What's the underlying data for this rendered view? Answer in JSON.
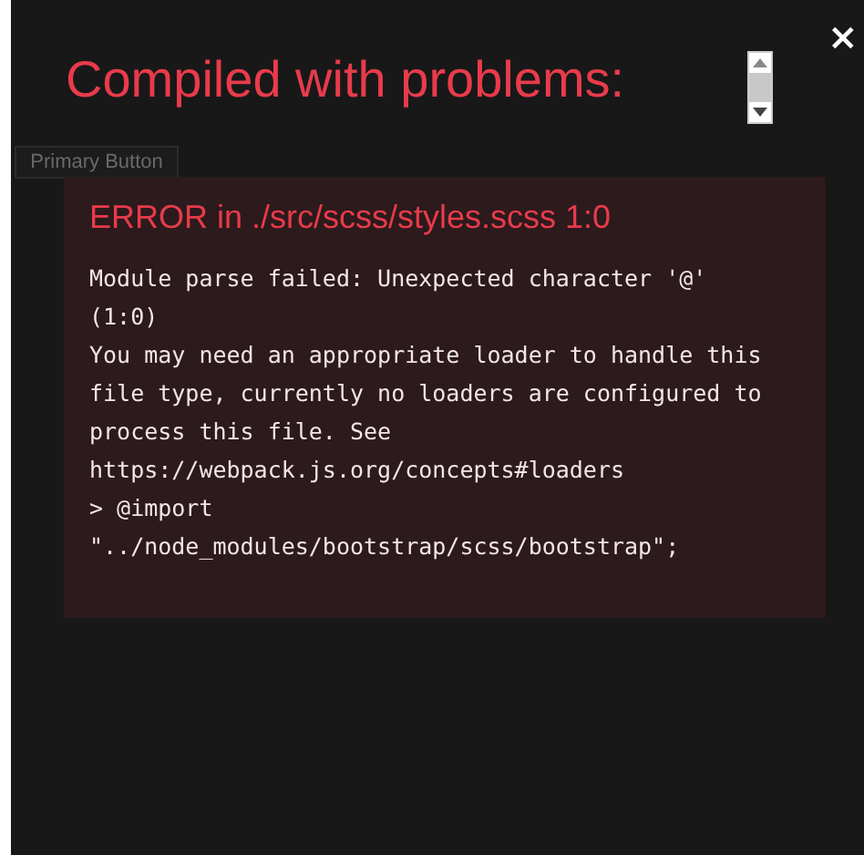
{
  "page": {
    "button": "Primary Button"
  },
  "overlay": {
    "title": "Compiled with problems:",
    "close": "×",
    "errors": [
      {
        "header": "ERROR in ./src/scss/styles.scss 1:0",
        "message": "Module parse failed: Unexpected character '@'\n(1:0)\nYou may need an appropriate loader to handle this\nfile type, currently no loaders are configured to\nprocess this file. See\nhttps://webpack.js.org/concepts#loaders\n> @import\n\"../node_modules/bootstrap/scss/bootstrap\";"
      }
    ]
  }
}
